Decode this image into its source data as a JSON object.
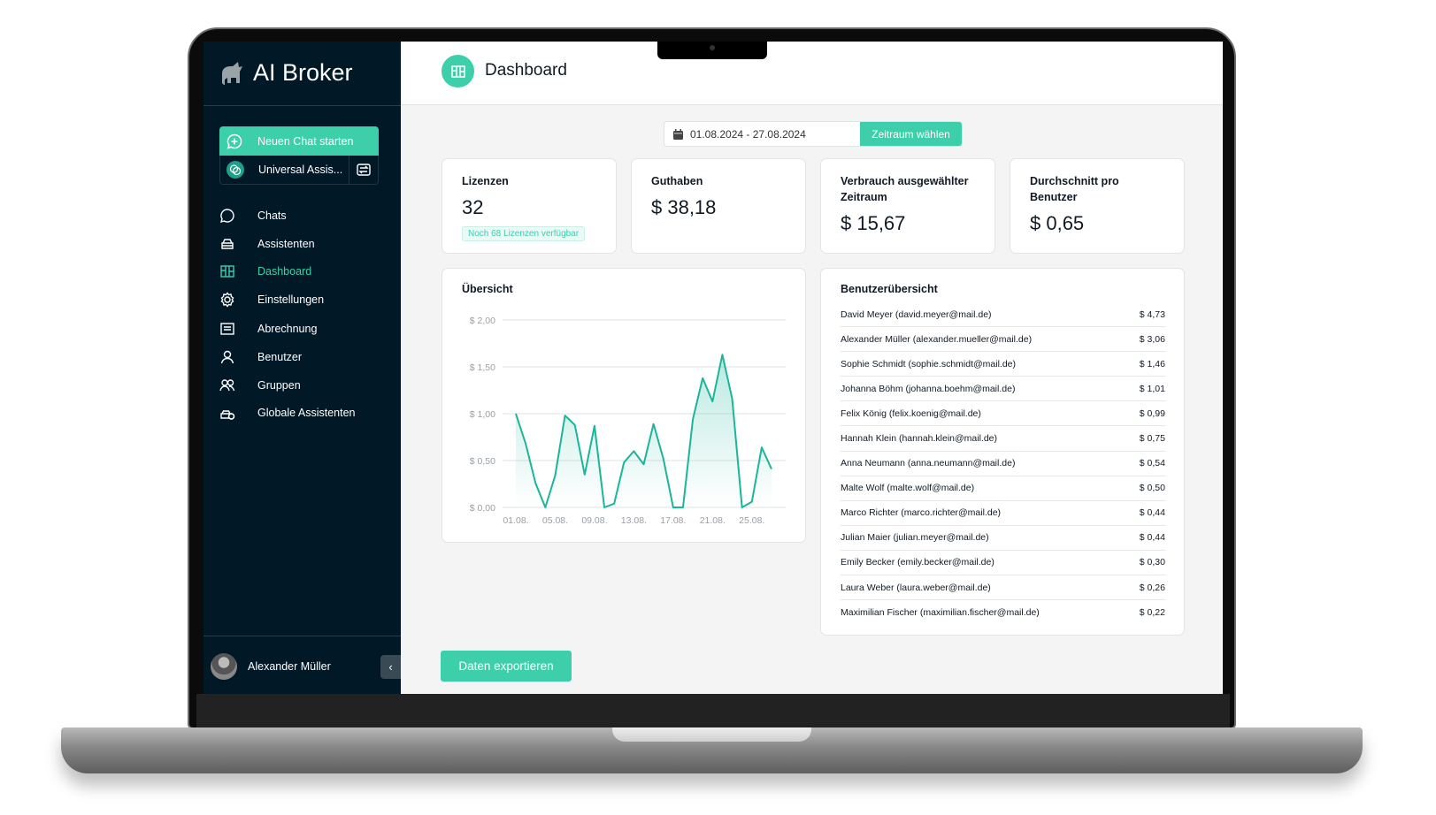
{
  "app": {
    "name": "AI Broker"
  },
  "sidebar": {
    "new_chat": "Neuen Chat starten",
    "assistant": "Universal Assis...",
    "items": [
      {
        "label": "Chats",
        "icon": "chat-bubble-icon"
      },
      {
        "label": "Assistenten",
        "icon": "tray-icon"
      },
      {
        "label": "Dashboard",
        "icon": "dashboard-icon",
        "active": true
      },
      {
        "label": "Einstellungen",
        "icon": "gear-icon"
      },
      {
        "label": "Abrechnung",
        "icon": "receipt-icon"
      },
      {
        "label": "Benutzer",
        "icon": "user-icon"
      },
      {
        "label": "Gruppen",
        "icon": "users-icon"
      },
      {
        "label": "Globale Assistenten",
        "icon": "global-assistant-icon"
      }
    ],
    "user": "Alexander Müller"
  },
  "header": {
    "title": "Dashboard"
  },
  "date_range": {
    "value": "01.08.2024 - 27.08.2024",
    "button": "Zeitraum wählen"
  },
  "stats": [
    {
      "title": "Lizenzen",
      "value": "32",
      "badge": "Noch 68 Lizenzen verfügbar"
    },
    {
      "title": "Guthaben",
      "value": "$ 38,18"
    },
    {
      "title": "Verbrauch ausgewählter Zeitraum",
      "value": "$ 15,67"
    },
    {
      "title": "Durchschnitt pro Benutzer",
      "value": "$ 0,65"
    }
  ],
  "chart_data": {
    "type": "area",
    "title": "Übersicht",
    "x": [
      "01.08.",
      "02.08.",
      "03.08.",
      "04.08.",
      "05.08.",
      "06.08.",
      "07.08.",
      "08.08.",
      "09.08.",
      "10.08.",
      "11.08.",
      "12.08.",
      "13.08.",
      "14.08.",
      "15.08.",
      "16.08.",
      "17.08.",
      "18.08.",
      "19.08.",
      "20.08.",
      "21.08.",
      "22.08.",
      "23.08.",
      "24.08.",
      "25.08.",
      "26.08.",
      "27.08."
    ],
    "values": [
      1.0,
      0.68,
      0.26,
      0.0,
      0.34,
      0.98,
      0.88,
      0.35,
      0.87,
      0.0,
      0.04,
      0.48,
      0.6,
      0.46,
      0.89,
      0.52,
      0.0,
      0.0,
      0.94,
      1.38,
      1.13,
      1.63,
      1.16,
      0.0,
      0.06,
      0.64,
      0.41
    ],
    "xticks": [
      "01.08.",
      "05.08.",
      "09.08.",
      "13.08.",
      "17.08.",
      "21.08.",
      "25.08."
    ],
    "yticks": [
      "$ 0,00",
      "$ 0,50",
      "$ 1,00",
      "$ 1,50",
      "$ 2,00"
    ],
    "ytick_values": [
      0,
      0.5,
      1,
      1.5,
      2
    ],
    "ylim": [
      0,
      2
    ],
    "grid": true,
    "color": "#1bb59a"
  },
  "users": {
    "title": "Benutzerübersicht",
    "rows": [
      {
        "name": "David Meyer (david.meyer@mail.de)",
        "amount": "$ 4,73"
      },
      {
        "name": "Alexander Müller (alexander.mueller@mail.de)",
        "amount": "$ 3,06"
      },
      {
        "name": "Sophie Schmidt (sophie.schmidt@mail.de)",
        "amount": "$ 1,46"
      },
      {
        "name": "Johanna Böhm (johanna.boehm@mail.de)",
        "amount": "$ 1,01"
      },
      {
        "name": "Felix König (felix.koenig@mail.de)",
        "amount": "$ 0,99"
      },
      {
        "name": "Hannah Klein (hannah.klein@mail.de)",
        "amount": "$ 0,75"
      },
      {
        "name": "Anna Neumann (anna.neumann@mail.de)",
        "amount": "$ 0,54"
      },
      {
        "name": "Malte Wolf (malte.wolf@mail.de)",
        "amount": "$ 0,50"
      },
      {
        "name": "Marco Richter (marco.richter@mail.de)",
        "amount": "$ 0,44"
      },
      {
        "name": "Julian Maier (julian.meyer@mail.de)",
        "amount": "$ 0,44"
      },
      {
        "name": "Emily Becker (emily.becker@mail.de)",
        "amount": "$ 0,30"
      },
      {
        "name": "Laura Weber (laura.weber@mail.de)",
        "amount": "$ 0,26"
      },
      {
        "name": "Maximilian Fischer (maximilian.fischer@mail.de)",
        "amount": "$ 0,22"
      }
    ]
  },
  "export": {
    "label": "Daten exportieren"
  },
  "colors": {
    "accent": "#3ccfa9",
    "sidebar": "#011826",
    "background": "#f4f4f4"
  }
}
